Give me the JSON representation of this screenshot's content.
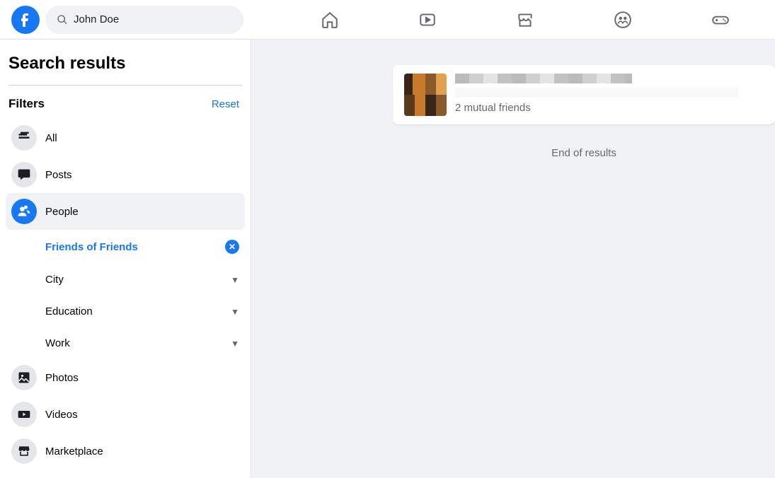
{
  "header": {
    "search_value": "John Doe"
  },
  "sidebar": {
    "title": "Search results",
    "filters_label": "Filters",
    "reset_label": "Reset",
    "items": [
      {
        "label": "All"
      },
      {
        "label": "Posts"
      },
      {
        "label": "People"
      },
      {
        "label": "Photos"
      },
      {
        "label": "Videos"
      },
      {
        "label": "Marketplace"
      }
    ],
    "people_sub": [
      {
        "label": "Friends of Friends",
        "active": true
      },
      {
        "label": "City"
      },
      {
        "label": "Education"
      },
      {
        "label": "Work"
      }
    ]
  },
  "results": {
    "mutual_text": "2 mutual friends",
    "end_text": "End of results"
  }
}
